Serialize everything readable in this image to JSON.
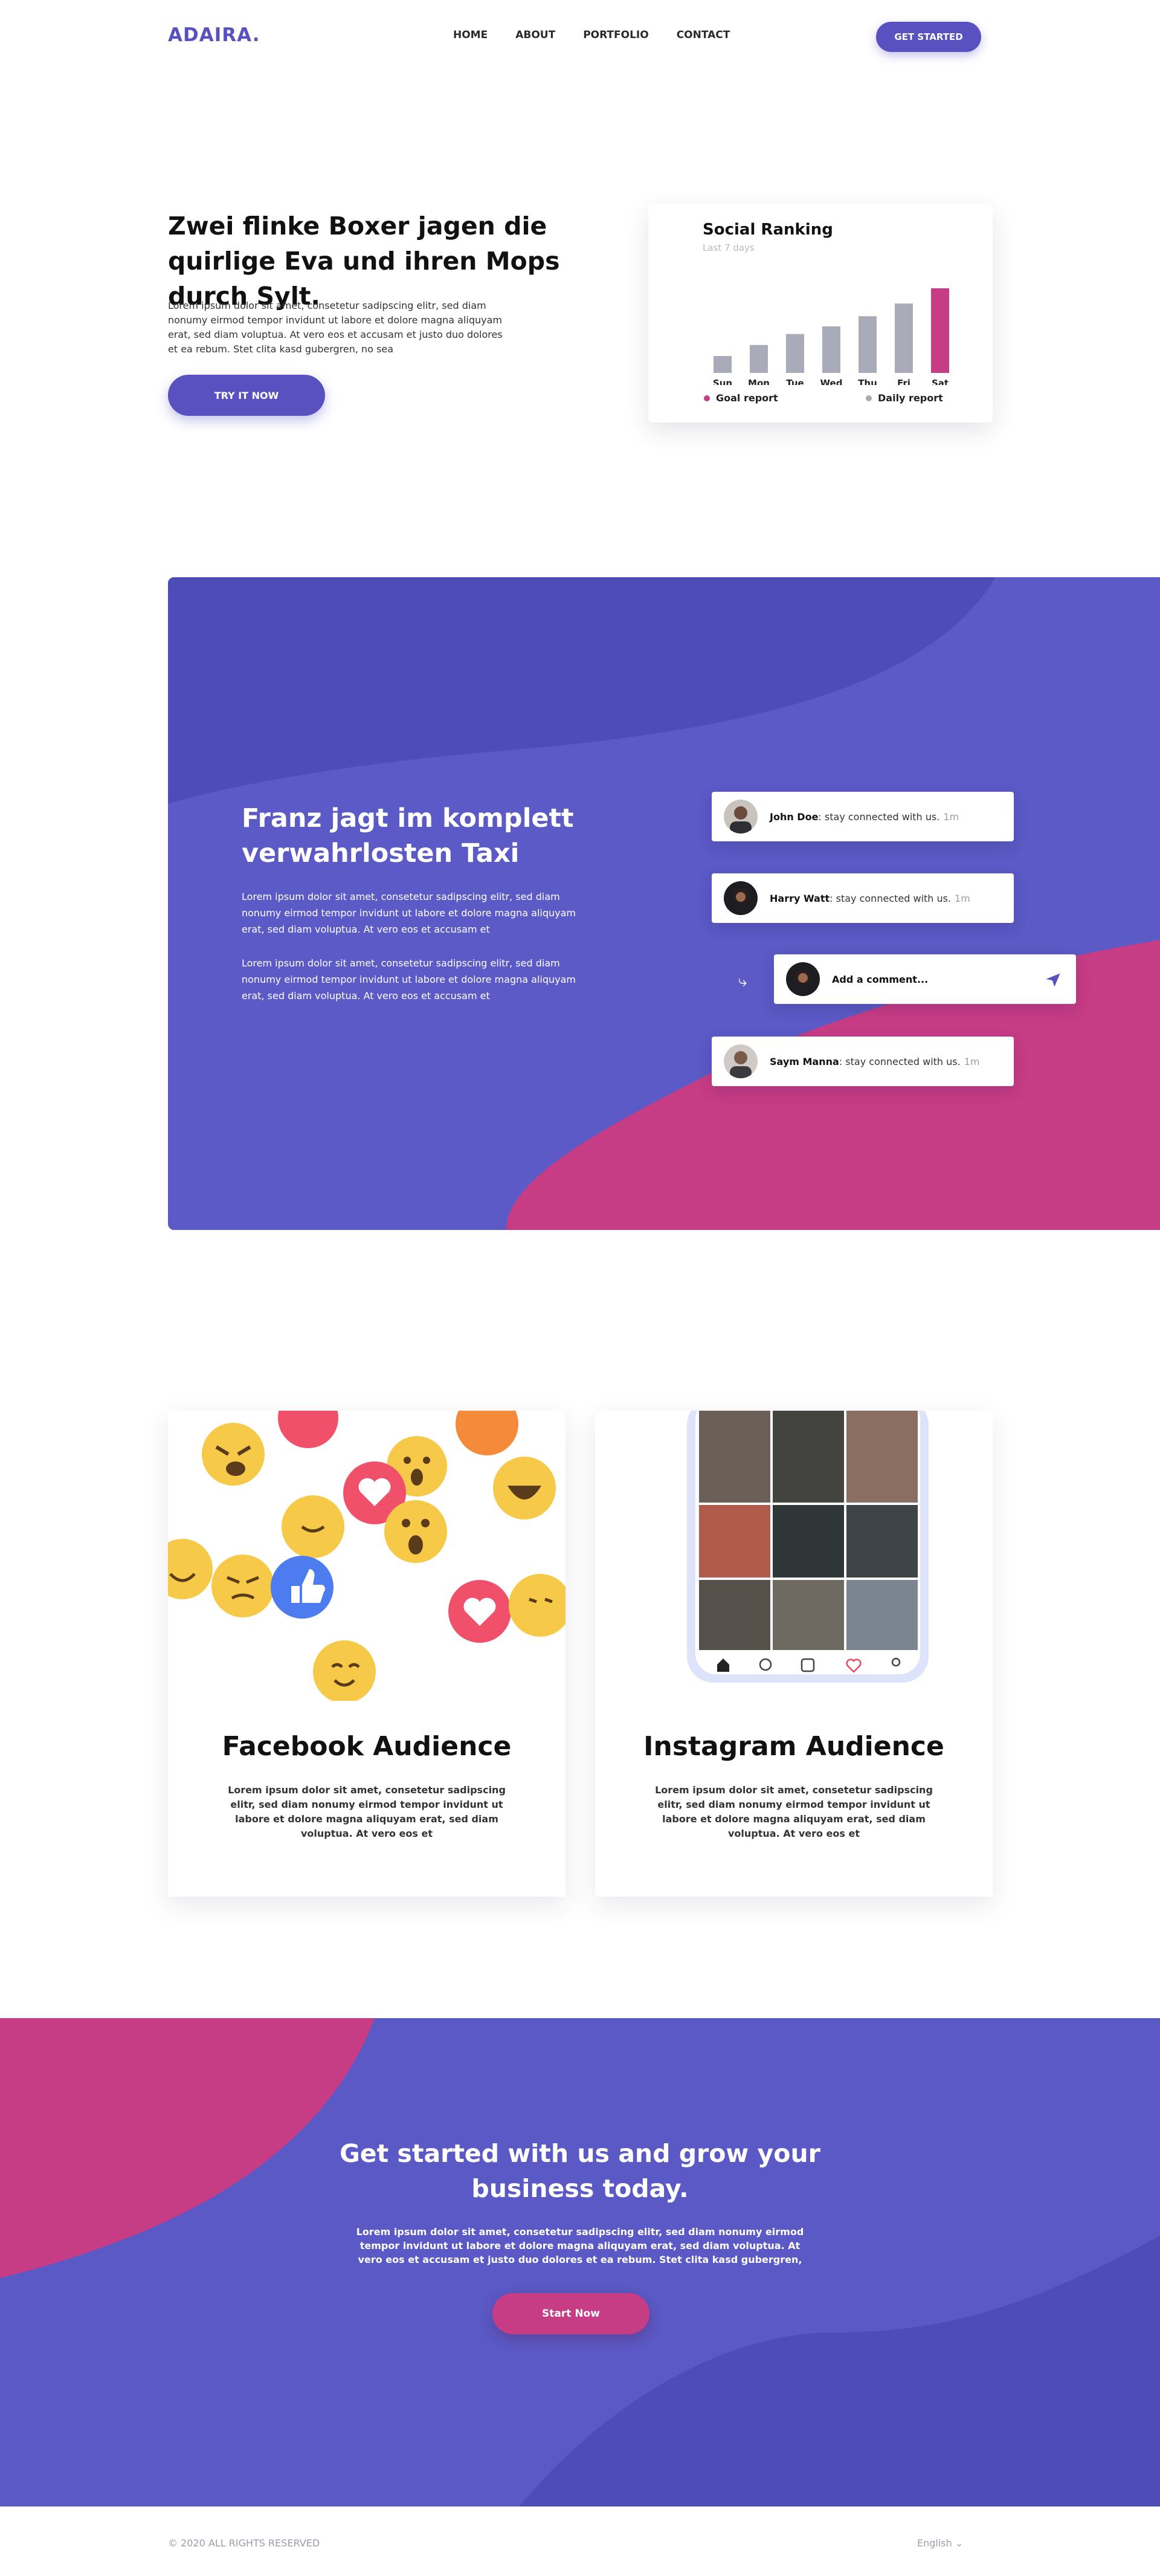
{
  "nav": {
    "logo": "ADAIRA.",
    "items": [
      "HOME",
      "ABOUT",
      "PORTFOLIO",
      "CONTACT"
    ],
    "cta_label": "GET STARTED"
  },
  "hero": {
    "title": "Zwei flinke Boxer jagen die quirlige Eva und ihren Mops durch Sylt.",
    "text": "Lorem ipsum dolor sit amet, consetetur sadipscing elitr, sed diam nonumy eirmod tempor invidunt ut labore et dolore magna aliquyam erat, sed diam voluptua. At vero eos et accusam et justo duo dolores et ea rebum. Stet clita kasd gubergren, no sea",
    "button_label": "TRY IT NOW"
  },
  "ranking": {
    "title": "Social Ranking",
    "subtitle": "Last 7 days",
    "legend": [
      {
        "label": "Goal report",
        "color": "#c63c85"
      },
      {
        "label": "Daily report",
        "color": "#a9acb8"
      }
    ]
  },
  "chart_data": {
    "type": "bar",
    "categories": [
      "Sun",
      "Mon",
      "Tue",
      "Wed",
      "Thu",
      "Fri",
      "Sat"
    ],
    "values": [
      20,
      33,
      46,
      55,
      67,
      82,
      100
    ],
    "highlight_index": 6,
    "colors": {
      "default": "#a9acb8",
      "highlight": "#c63c85"
    },
    "title": "Social Ranking",
    "xlabel": "",
    "ylabel": "",
    "ylim": [
      0,
      100
    ],
    "grid": false
  },
  "section2": {
    "title": "Franz jagt im komplett verwahrlosten Taxi",
    "p1": "Lorem ipsum dolor sit amet, consetetur sadipscing elitr, sed diam nonumy eirmod tempor invidunt ut labore et dolore magna aliquyam erat, sed diam voluptua. At vero eos et accusam et",
    "p2": "Lorem ipsum dolor sit amet, consetetur sadipscing elitr, sed diam nonumy eirmod tempor invidunt ut labore et dolore magna aliquyam erat, sed diam voluptua. At vero eos et accusam et",
    "comments": [
      {
        "name": "John Doe",
        "text": ": stay connected with us.",
        "time": "1m"
      },
      {
        "name": "Harry Watt",
        "text": ": stay connected with us.",
        "time": "1m"
      },
      {
        "name": "Saym Manna",
        "text": ": stay connected with us.",
        "time": "1m"
      }
    ],
    "add_comment_placeholder": "Add a comment..."
  },
  "cards": [
    {
      "title": "Facebook Audience",
      "text": "Lorem ipsum dolor sit amet, consetetur sadipscing elitr, sed diam nonumy eirmod tempor invidunt ut labore et dolore magna aliquyam erat, sed diam voluptua. At vero eos et"
    },
    {
      "title": "Instagram Audience",
      "text": "Lorem ipsum dolor sit amet, consetetur sadipscing elitr, sed diam nonumy eirmod tempor invidunt ut labore et dolore magna aliquyam erat, sed diam voluptua. At vero eos et"
    }
  ],
  "cta": {
    "title": "Get started with us and grow your business today.",
    "text": "Lorem ipsum dolor sit amet, consetetur sadipscing elitr, sed diam nonumy eirmod tempor invidunt ut labore et dolore magna aliquyam erat, sed diam voluptua. At vero eos et accusam et justo duo dolores et ea rebum. Stet clita kasd gubergren,",
    "button_label": "Start Now"
  },
  "footer": {
    "copyright": "© 2020 ALL RIGHTS RESERVED",
    "language": "English"
  },
  "colors": {
    "primary": "#5a51c1",
    "accent": "#c63c85",
    "bar_grey": "#a9acb8"
  },
  "icons": [
    "reply-arrow-icon",
    "send-icon",
    "chevron-down-icon",
    "home-icon",
    "search-icon",
    "add-icon",
    "heart-icon",
    "profile-icon",
    "like-icon",
    "heart-icon",
    "emoji-icon"
  ]
}
